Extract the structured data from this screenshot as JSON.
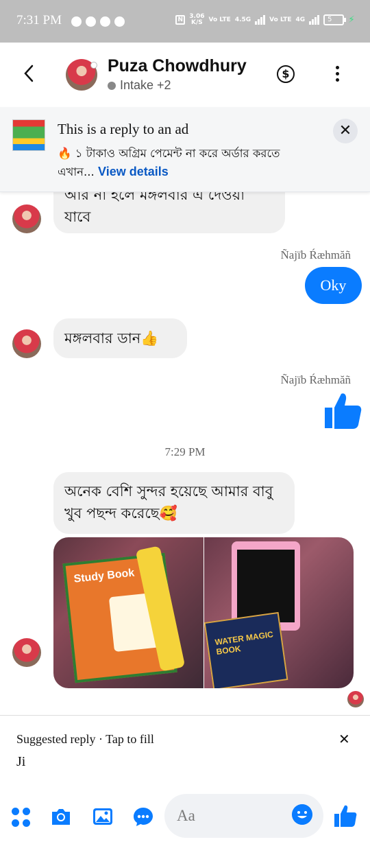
{
  "status_bar": {
    "time": "7:31 PM",
    "speed": "3.06",
    "speed_unit": "K/S",
    "net1": "Vo LTE",
    "net1_gen": "4.5G",
    "net2": "Vo LTE",
    "net2_gen": "4G",
    "battery": "5"
  },
  "header": {
    "contact_name": "Puza Chowdhury",
    "subtitle": "Intake +2"
  },
  "ad_banner": {
    "title": "This is a reply to an ad",
    "emoji": "🔥",
    "body": "১ টাকাও অগ্রিম পেমেন্ট না করে অর্ডার করতে এখান...",
    "link": "View details"
  },
  "messages": {
    "m1_text": "আর না হলে মঙ্গলবার এ দেওয়া যাবে",
    "sender1": "Ñajïb Ŕæhmăñ",
    "m2_text": "Oky",
    "m3_text": "মঙ্গলবার ডান👍",
    "sender2": "Ñajïb Ŕæhmăñ",
    "timestamp": "7:29 PM",
    "m4_text": "অনেক বেশি সুন্দর হয়েছে আমার বাবু খুব পছন্দ করেছে🥰",
    "photo1_text": "Study Book",
    "photo2_text": "WATER MAGIC BOOK"
  },
  "suggested": {
    "label": "Suggested reply · Tap to fill",
    "text": "Ji"
  },
  "composer": {
    "placeholder": "Aa"
  },
  "colors": {
    "accent": "#0a7cff",
    "link": "#0a59c4",
    "bubble_in": "#f0f0f0"
  }
}
